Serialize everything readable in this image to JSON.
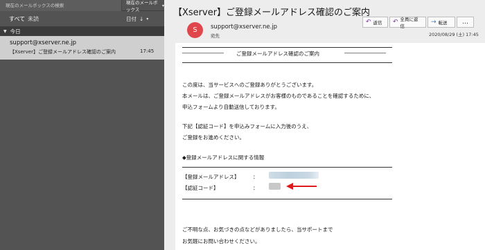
{
  "list_pane": {
    "search_placeholder": "現在のメールボックスの検索",
    "scope_label": "現在のメールボックス",
    "filters": {
      "all": "すべて",
      "unread": "未読"
    },
    "sort_label": "日付",
    "sort_direction_glyph": "↓",
    "group_label": "今日",
    "messages": [
      {
        "from": "support@xserver.ne.jp",
        "subject": "【Xserver】ご登録メールアドレス確認のご案内",
        "time": "17:45"
      }
    ]
  },
  "reading_pane": {
    "title": "【Xserver】ご登録メールアドレス確認のご案内",
    "avatar_initial": "S",
    "avatar_color": "#e0474c",
    "sender": "support@xserver.ne.jp",
    "to_label": "宛先",
    "actions": {
      "reply": "返信",
      "reply_all": "全員に返信",
      "forward": "転送",
      "more": "…"
    },
    "date": "2020/08/29 (土) 17:45",
    "body": {
      "heading_left_rule": "――――――――",
      "heading": "ご登録メールアドレス確認のご案内",
      "heading_right_rule": "――――――――",
      "para1_line1": "この度は、当サービスへのご登録ありがとうございます。",
      "para1_line2": "本メールは、ご登録メールアドレスがお客様のものであることを確認するために、",
      "para1_line3": "申込フォームより自動送信しております。",
      "para2_line1": "下記【認証コード】を申込みフォームに入力後のうえ、",
      "para2_line2": "ご登録をお進めください。",
      "info_heading": "◆登録メールアドレスに関する情報",
      "email_label": "【登録メールアドレス】",
      "code_label": "【認証コード】",
      "colon": "：",
      "closing_line1": "ご不明な点、お気づきの点などがありましたら、当サポートまで",
      "closing_line2": "お気軽にお問い合わせください。"
    }
  },
  "colors": {
    "accent_arrow": "#e01a1a",
    "reply_icon": "#7b3d9b",
    "forward_icon": "#3a6fb5"
  }
}
